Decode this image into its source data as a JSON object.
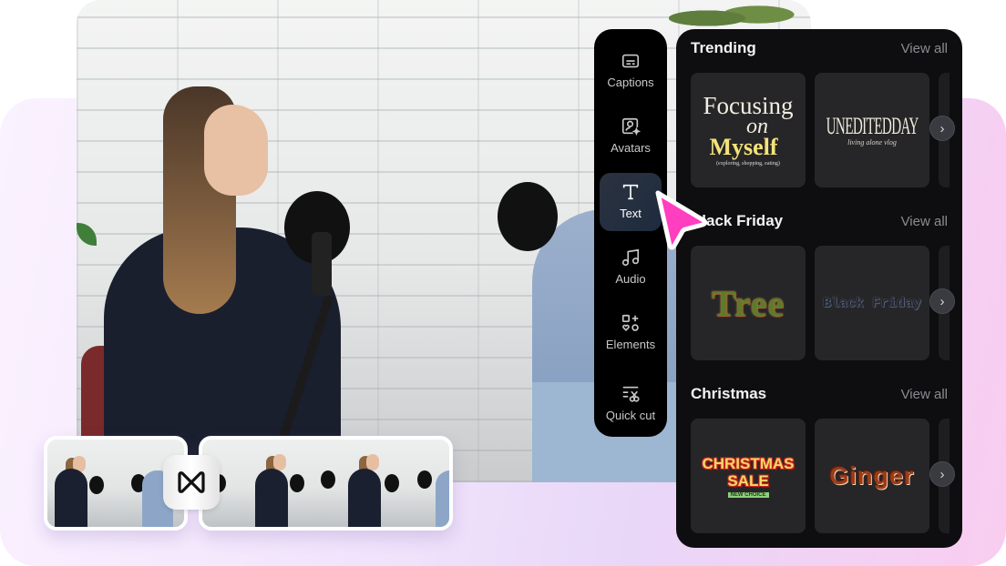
{
  "sidebar": {
    "items": [
      {
        "label": "Captions",
        "icon": "captions-icon",
        "active": false
      },
      {
        "label": "Avatars",
        "icon": "avatar-icon",
        "active": false
      },
      {
        "label": "Text",
        "icon": "text-icon",
        "active": true
      },
      {
        "label": "Audio",
        "icon": "music-note-icon",
        "active": false
      },
      {
        "label": "Elements",
        "icon": "elements-icon",
        "active": false
      },
      {
        "label": "Quick cut",
        "icon": "quick-cut-icon",
        "active": false
      }
    ]
  },
  "panel": {
    "sections": [
      {
        "title": "Trending",
        "view_all": "View all",
        "cards": [
          {
            "name": "focusing-on-myself",
            "lines": [
              "Focusing",
              "on",
              "Myself",
              "(exploring, shopping, eating)"
            ]
          },
          {
            "name": "unediteddday",
            "lines": [
              "UNEDITEDDAY",
              "living alone vlog"
            ]
          }
        ]
      },
      {
        "title": "Black Friday",
        "view_all": "View all",
        "cards": [
          {
            "name": "tree",
            "lines": [
              "Tree"
            ]
          },
          {
            "name": "black-friday",
            "lines": [
              "Black Friday"
            ]
          }
        ]
      },
      {
        "title": "Christmas",
        "view_all": "View all",
        "cards": [
          {
            "name": "christmas-sale",
            "lines": [
              "CHRISTMAS",
              "SALE",
              "NEW CHOICE"
            ]
          },
          {
            "name": "ginger",
            "lines": [
              "Ginger"
            ]
          }
        ]
      }
    ],
    "next_icon": "›"
  },
  "colors": {
    "accent_cursor": "#ff3fbf",
    "panel_bg": "#0e0e10",
    "rail_bg": "#000000",
    "bg_gradient_start": "#fbf2ff",
    "bg_gradient_end": "#f9cdf0"
  }
}
